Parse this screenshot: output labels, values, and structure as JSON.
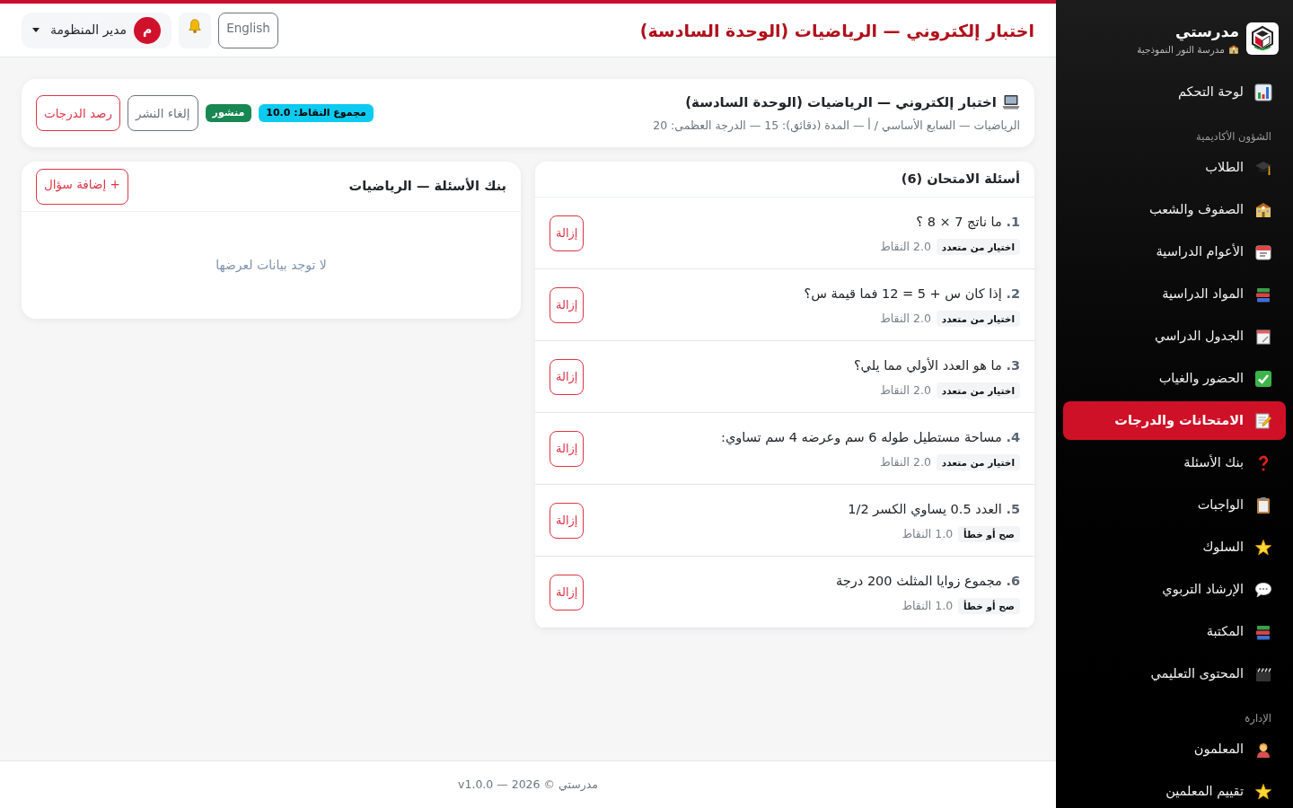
{
  "header": {
    "title": "اختبار إلكتروني — الرياضيات (الوحدة السادسة)",
    "language_button": "English",
    "user": {
      "initial": "م",
      "name": "مدير المنظومة"
    }
  },
  "sidebar": {
    "brand": {
      "name": "مدرستي",
      "school": "مدرسة النور النموذجية"
    },
    "sections": [
      {
        "items": [
          {
            "label": "لوحة التحكم",
            "selected": false
          }
        ]
      },
      {
        "title": "الشؤون الأكاديمية",
        "items": [
          {
            "label": "الطلاب",
            "selected": false
          },
          {
            "label": "الصفوف والشعب",
            "selected": false
          },
          {
            "label": "الأعوام الدراسية",
            "selected": false
          },
          {
            "label": "المواد الدراسية",
            "selected": false
          },
          {
            "label": "الجدول الدراسي",
            "selected": false
          },
          {
            "label": "الحضور والغياب",
            "selected": false
          },
          {
            "label": "الامتحانات والدرجات",
            "selected": true
          },
          {
            "label": "بنك الأسئلة",
            "selected": false
          },
          {
            "label": "الواجبات",
            "selected": false
          },
          {
            "label": "السلوك",
            "selected": false
          },
          {
            "label": "الإرشاد التربوي",
            "selected": false
          },
          {
            "label": "المكتبة",
            "selected": false
          },
          {
            "label": "المحتوى التعليمي",
            "selected": false
          }
        ]
      },
      {
        "title": "الإدارة",
        "items": [
          {
            "label": "المعلمون",
            "selected": false
          },
          {
            "label": "تقييم المعلمين",
            "selected": false
          }
        ]
      }
    ]
  },
  "exam": {
    "title": "اختبار إلكتروني — الرياضيات (الوحدة السادسة)",
    "details": "الرياضيات — السابع الأساسي / أ — المدة (دقائق): 15 — الدرجة العظمى: 20",
    "total_badge": "مجموع النقاط: 10.0",
    "status_badge": "منشور",
    "actions": [
      {
        "label": "إلغاء النشر",
        "kind": "secondary"
      },
      {
        "label": "رصد الدرجات",
        "kind": "primary"
      }
    ]
  },
  "exam_questions": {
    "title": "أسئلة الامتحان (6)",
    "items": [
      {
        "number": "1.",
        "text": "ما ناتج 7 × 8 ؟",
        "type_label": "اختيار من متعدد",
        "points": "2.0 النقاط",
        "remove_button": "إزالة"
      },
      {
        "number": "2.",
        "text": "إذا كان س + 5 = 12 فما قيمة س؟",
        "type_label": "اختيار من متعدد",
        "points": "2.0 النقاط",
        "remove_button": "إزالة"
      },
      {
        "number": "3.",
        "text": "ما هو العدد الأولي مما يلي؟",
        "type_label": "اختيار من متعدد",
        "points": "2.0 النقاط",
        "remove_button": "إزالة"
      },
      {
        "number": "4.",
        "text": "مساحة مستطيل طوله 6 سم وعرضه 4 سم تساوي:",
        "type_label": "اختيار من متعدد",
        "points": "2.0 النقاط",
        "remove_button": "إزالة"
      },
      {
        "number": "5.",
        "text": "العدد 0.5 يساوي الكسر 1/2",
        "type_label": "صح أو خطأ",
        "points": "1.0 النقاط",
        "remove_button": "إزالة"
      },
      {
        "number": "6.",
        "text": "مجموع زوايا المثلث 200 درجة",
        "type_label": "صح أو خطأ",
        "points": "1.0 النقاط",
        "remove_button": "إزالة"
      }
    ]
  },
  "question_bank": {
    "title": "بنك الأسئلة — الرياضيات",
    "add_button": "+ إضافة سؤال",
    "empty_message": "لا توجد بيانات لعرضها"
  },
  "footer": {
    "text": "مدرستي © 2026 — v1.0.0"
  }
}
